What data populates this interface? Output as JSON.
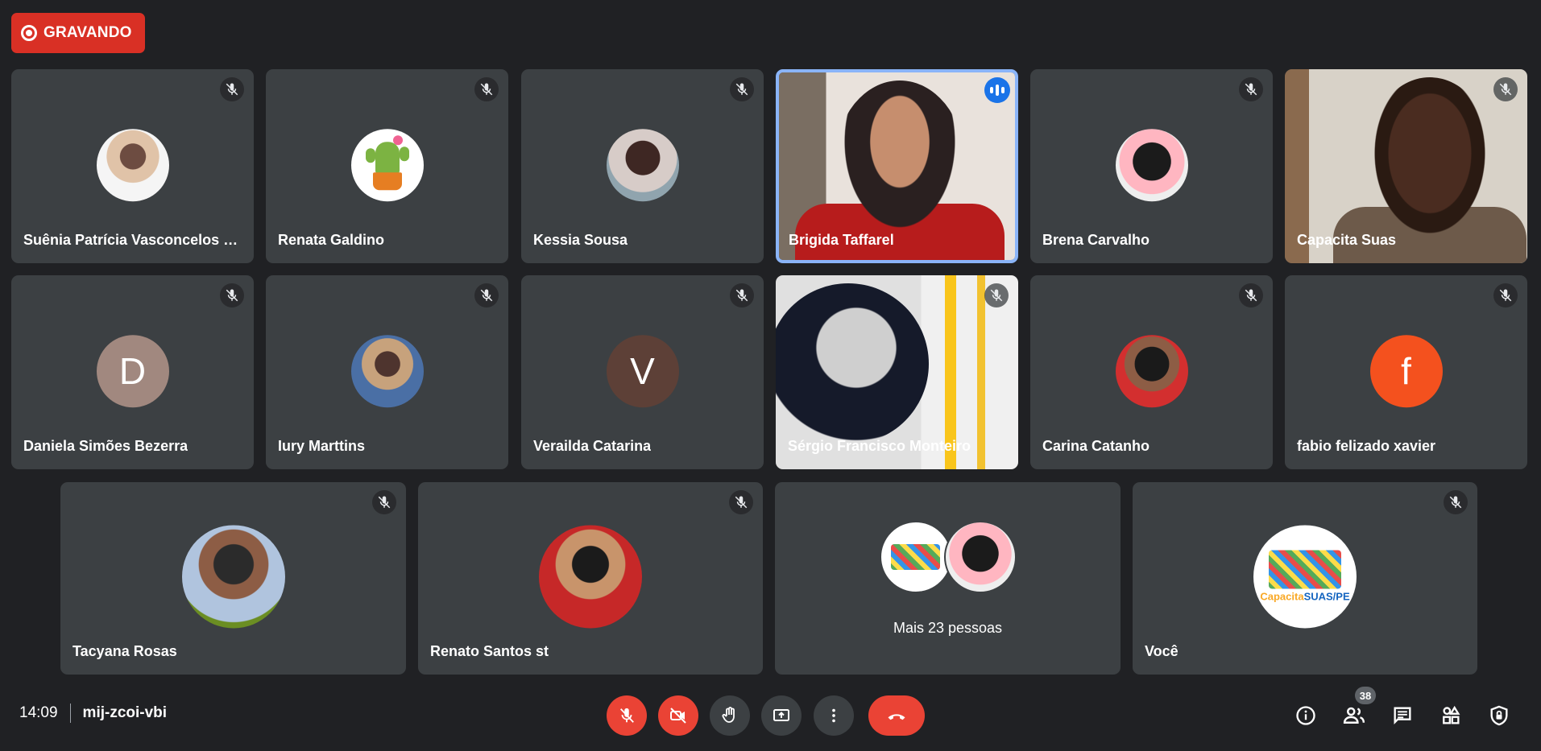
{
  "recording": {
    "label": "GRAVANDO"
  },
  "tiles": [
    {
      "name": "Suênia Patrícia Vasconcelos M..."
    },
    {
      "name": "Renata Galdino"
    },
    {
      "name": "Kessia Sousa"
    },
    {
      "name": "Brigida Taffarel"
    },
    {
      "name": "Brena Carvalho"
    },
    {
      "name": "Capacita Suas"
    },
    {
      "name": "Daniela Simões Bezerra",
      "initial": "D"
    },
    {
      "name": "Iury Marttins"
    },
    {
      "name": "Verailda Catarina",
      "initial": "V"
    },
    {
      "name": "Sérgio Francisco Monteiro"
    },
    {
      "name": "Carina Catanho"
    },
    {
      "name": "fabio felizado xavier",
      "initial": "f"
    },
    {
      "name": "Tacyana Rosas"
    },
    {
      "name": "Renato Santos st"
    },
    {
      "name": "Você"
    }
  ],
  "others": {
    "label": "Mais 23 pessoas"
  },
  "logo": {
    "part1": "Capacita",
    "part2": "SUAS/PE"
  },
  "footer": {
    "time": "14:09",
    "meeting_code": "mij-zcoi-vbi",
    "participant_count": "38"
  },
  "colors": {
    "accent": "#8ab4f8",
    "recording": "#d93025",
    "end_call": "#ea4335",
    "tile": "#3c4043",
    "background": "#202124"
  },
  "icons": [
    "mic-off-icon",
    "camera-off-icon",
    "raise-hand-icon",
    "present-icon",
    "more-options-icon",
    "end-call-icon",
    "info-icon",
    "people-icon",
    "chat-icon",
    "activities-icon",
    "host-controls-icon"
  ]
}
